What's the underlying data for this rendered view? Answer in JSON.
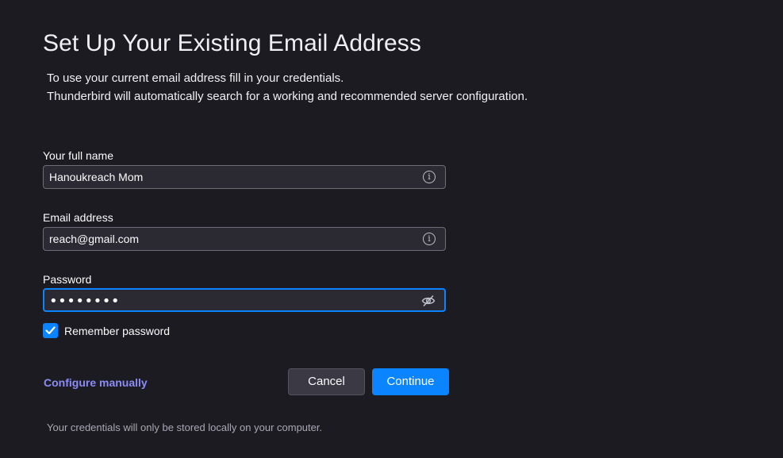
{
  "header": {
    "title": "Set Up Your Existing Email Address",
    "description_line1": "To use your current email address fill in your credentials.",
    "description_line2": "Thunderbird will automatically search for a working and recommended server configuration."
  },
  "form": {
    "full_name": {
      "label": "Your full name",
      "value": "Hanoukreach Mom",
      "icon": "info-icon"
    },
    "email": {
      "label": "Email address",
      "value": "reach@gmail.com",
      "icon": "info-icon"
    },
    "password": {
      "label": "Password",
      "masked_value": "••••••••",
      "icon": "eye-slash-icon"
    },
    "remember_password": {
      "label": "Remember password",
      "checked": true
    }
  },
  "actions": {
    "configure_manually": "Configure manually",
    "cancel": "Cancel",
    "continue": "Continue"
  },
  "footer": {
    "note": "Your credentials will only be stored locally on your computer."
  },
  "colors": {
    "background": "#1c1b22",
    "accent": "#0a84ff",
    "link": "#8c8cf5"
  }
}
